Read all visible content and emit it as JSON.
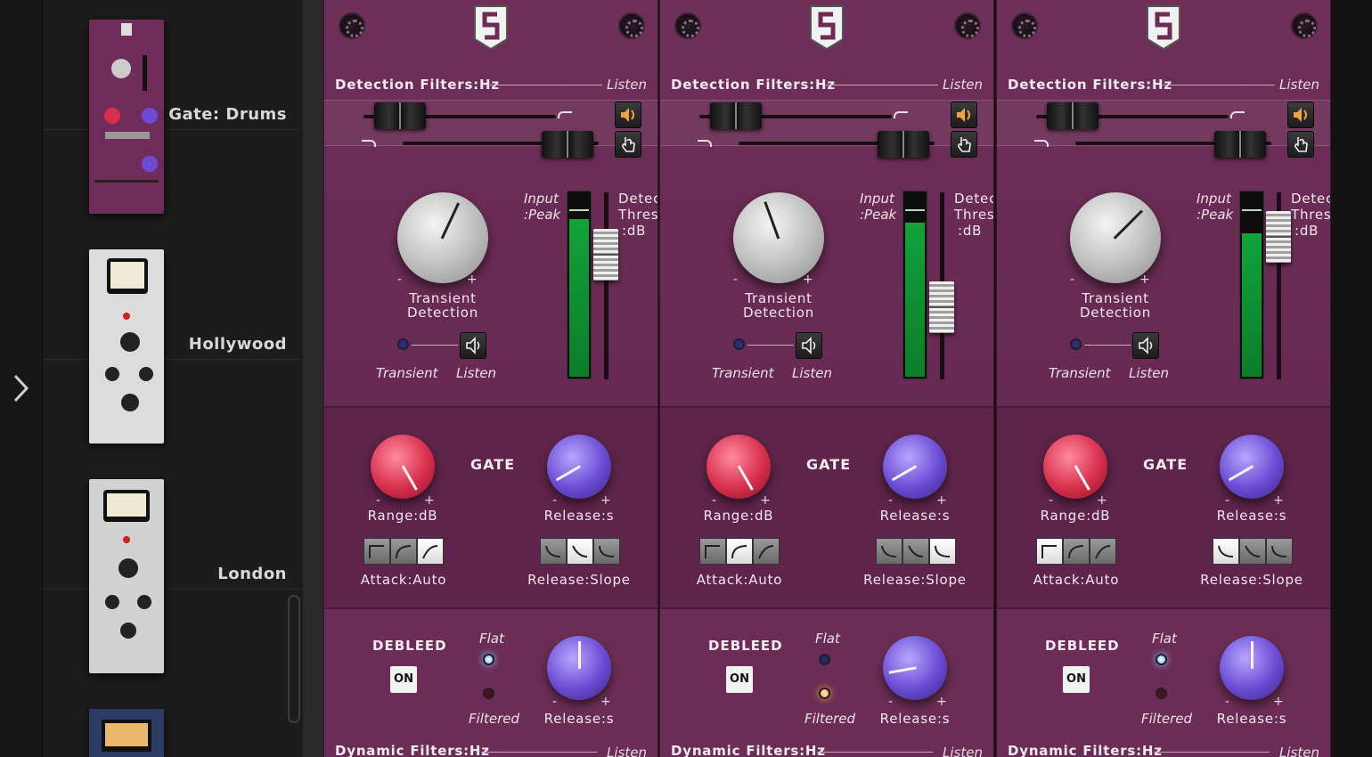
{
  "drawer": {
    "items": [
      {
        "label": "Gate: Drums",
        "thumb_caption": "GATE:DRUMS"
      },
      {
        "label": "Hollywood",
        "thumb_caption": "HOLLYWOOD"
      },
      {
        "label": "London",
        "thumb_caption": "LONDON"
      }
    ]
  },
  "strip": {
    "detection_title": "Detection Filters:Hz",
    "listen": "Listen",
    "input_label_1": "Input",
    "input_label_2": ":Peak",
    "detect_label_1": "Detect",
    "detect_label_2": "Thres.",
    "detect_label_3": ":dB",
    "transient_knob_1": "Transient",
    "transient_knob_2": "Detection",
    "transient": "Transient",
    "listen_small": "Listen",
    "minus": "-",
    "plus": "+",
    "gate_title": "GATE",
    "range": "Range:dB",
    "release": "Release:s",
    "attack": "Attack:Auto",
    "release_slope": "Release:Slope",
    "debleed_title": "DEBLEED",
    "on": "ON",
    "flat": "Flat",
    "filtered": "Filtered",
    "dynamic_title": "Dynamic Filters:Hz"
  },
  "colors": {
    "panel": "#6b2d55",
    "meter_green": "#0c7d2b",
    "knob_red": "#d8304c",
    "knob_purple": "#6a4cd4"
  },
  "strips": [
    {
      "meter_level": 0.86,
      "threshold_level": 0.73,
      "transient_angle": 25,
      "release_angle": -120,
      "deb_release_angle": 0,
      "attack_selected": 2,
      "slope_selected": 1,
      "flat_on": true
    },
    {
      "meter_level": 0.84,
      "threshold_level": 0.34,
      "transient_angle": -20,
      "release_angle": -120,
      "deb_release_angle": -100,
      "attack_selected": 1,
      "slope_selected": 2,
      "flat_on": false
    },
    {
      "meter_level": 0.78,
      "threshold_level": 0.86,
      "transient_angle": 45,
      "release_angle": -120,
      "deb_release_angle": 0,
      "attack_selected": 0,
      "slope_selected": 0,
      "flat_on": true
    }
  ]
}
